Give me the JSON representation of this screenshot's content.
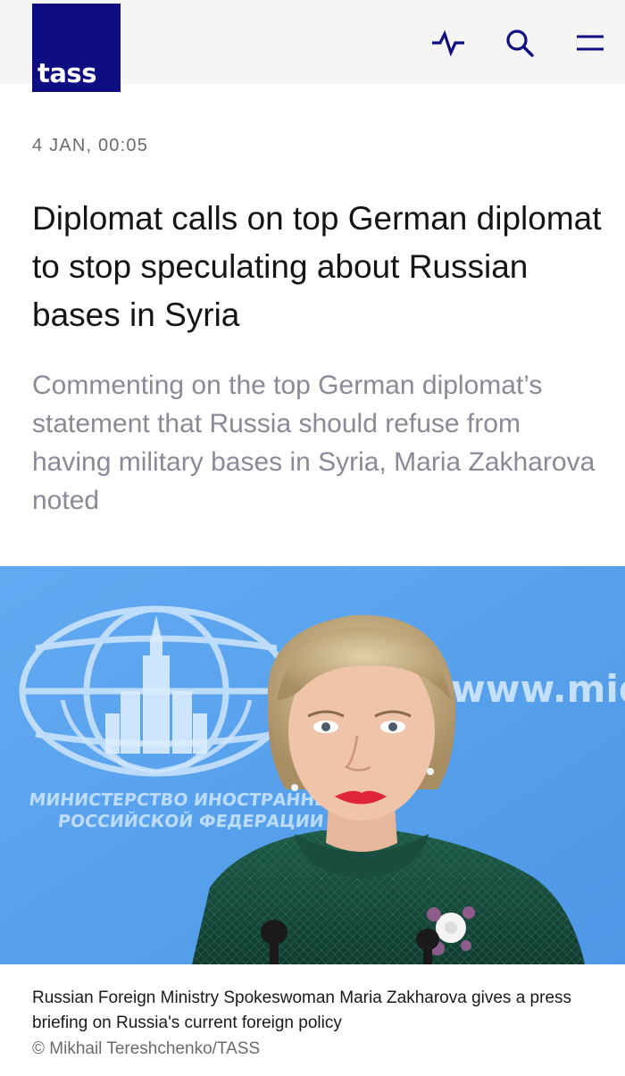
{
  "header": {
    "logo_text": "tass",
    "brand_color": "#0e0d82",
    "icons": [
      "pulse-icon",
      "search-icon",
      "menu-icon"
    ]
  },
  "article": {
    "date": "4 JAN, 00:05",
    "headline": "Diplomat calls on top German diplomat to stop speculating about Russian bases in Syria",
    "lead": "Commenting on the top German diplomat’s statement that Russia should refuse from having military bases in Syria, Maria Zakharova noted"
  },
  "photo": {
    "backdrop_url_text": "www.mid.ru",
    "emblem_line1": "МИНИСТЕРСТВО ИНОСТРАННЫХ ДЕЛ",
    "emblem_line2": "РОССИЙСКОЙ ФЕДЕРАЦИИ",
    "caption": "Russian Foreign Ministry Spokeswoman Maria Zakharova gives a press briefing on Russia's current foreign policy",
    "credit": "© Mikhail Tereshchenko/TASS"
  }
}
